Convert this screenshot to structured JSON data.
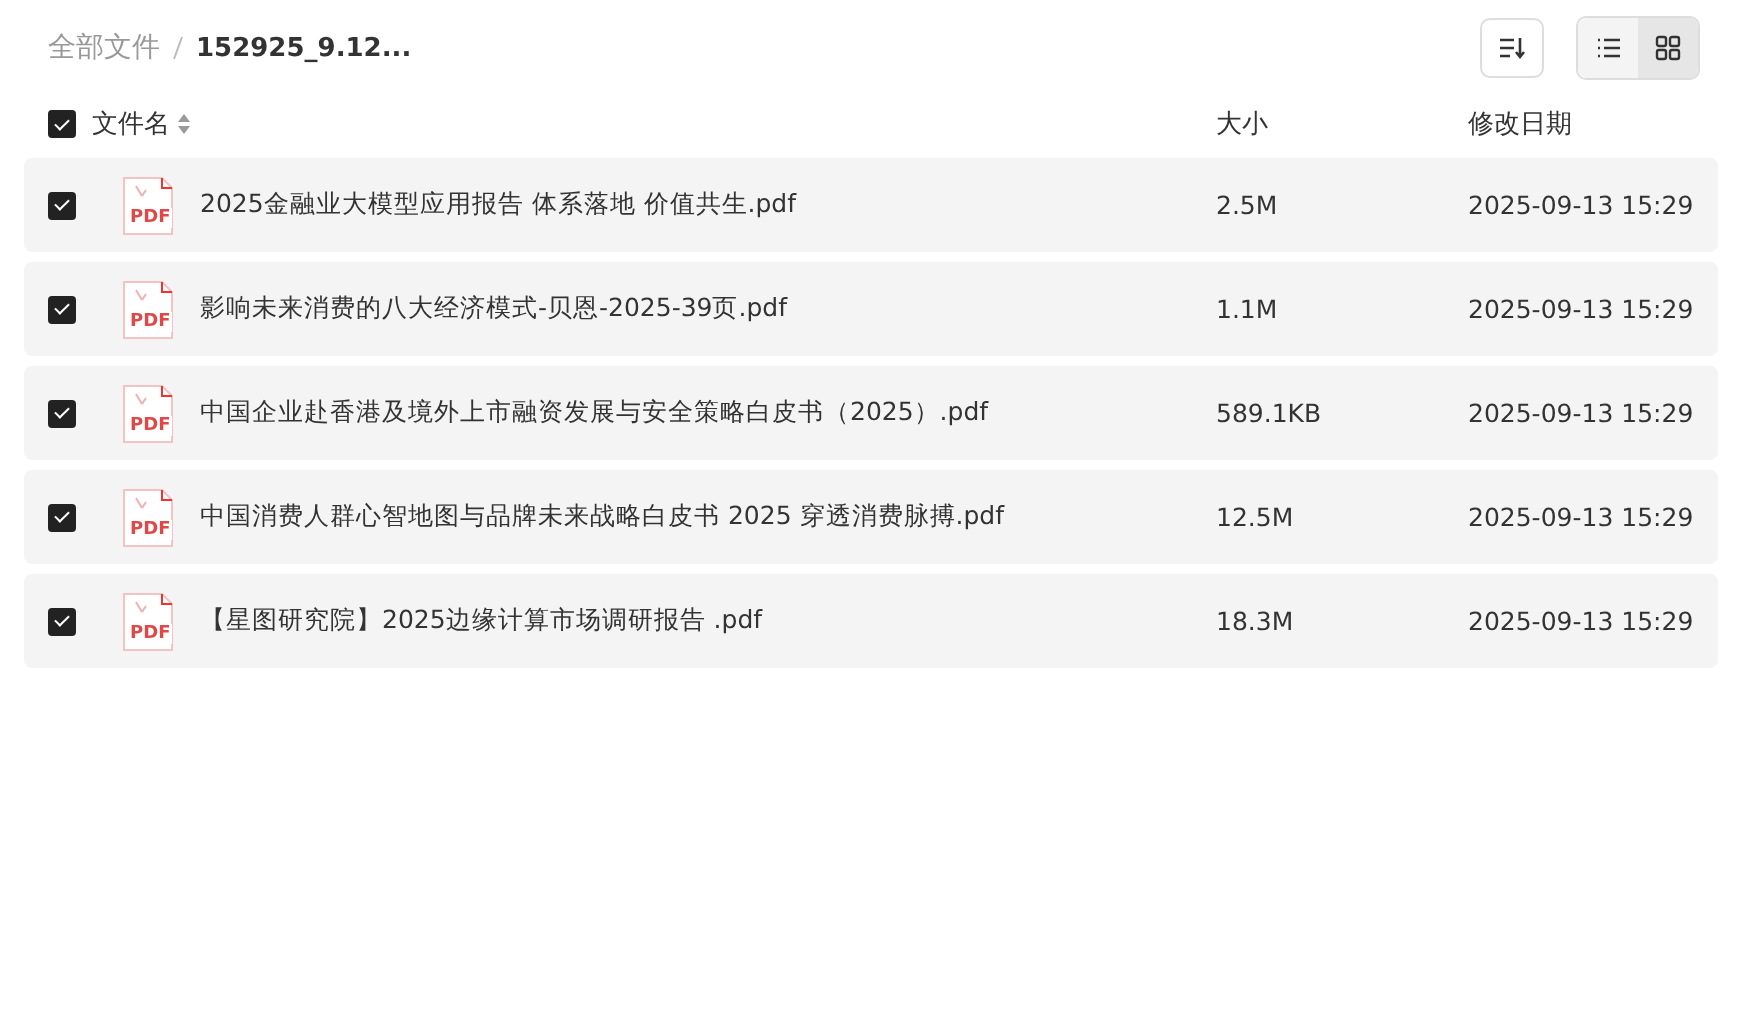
{
  "breadcrumb": [
    {
      "label": "全部文件",
      "current": false
    },
    {
      "label": "152925_9.12...",
      "current": true
    }
  ],
  "view_toggle": [
    {
      "kind": "list",
      "selected": false
    },
    {
      "kind": "grid",
      "selected": true
    }
  ],
  "header": {
    "checked": true,
    "columns": [
      "文件名",
      "大小",
      "修改日期"
    ]
  },
  "files": [
    {
      "icon_label": "PDF",
      "name": "2025金融业大模型应用报告 体系落地 价值共生.pdf",
      "size": "2.5M",
      "modified": "2025-09-13 15:29",
      "checked": true
    },
    {
      "icon_label": "PDF",
      "name": "影响未来消费的八大经济模式-贝恩-2025-39页.pdf",
      "size": "1.1M",
      "modified": "2025-09-13 15:29",
      "checked": true
    },
    {
      "icon_label": "PDF",
      "name": "中国企业赴香港及境外上市融资发展与安全策略白皮书（2025）.pdf",
      "size": "589.1KB",
      "modified": "2025-09-13 15:29",
      "checked": true
    },
    {
      "icon_label": "PDF",
      "name": "中国消费人群心智地图与品牌未来战略白皮书 2025 穿透消费脉搏.pdf",
      "size": "12.5M",
      "modified": "2025-09-13 15:29",
      "checked": true
    },
    {
      "icon_label": "PDF",
      "name": "【星图研究院】2025边缘计算市场调研报告 .pdf",
      "size": "18.3M",
      "modified": "2025-09-13 15:29",
      "checked": true
    }
  ]
}
